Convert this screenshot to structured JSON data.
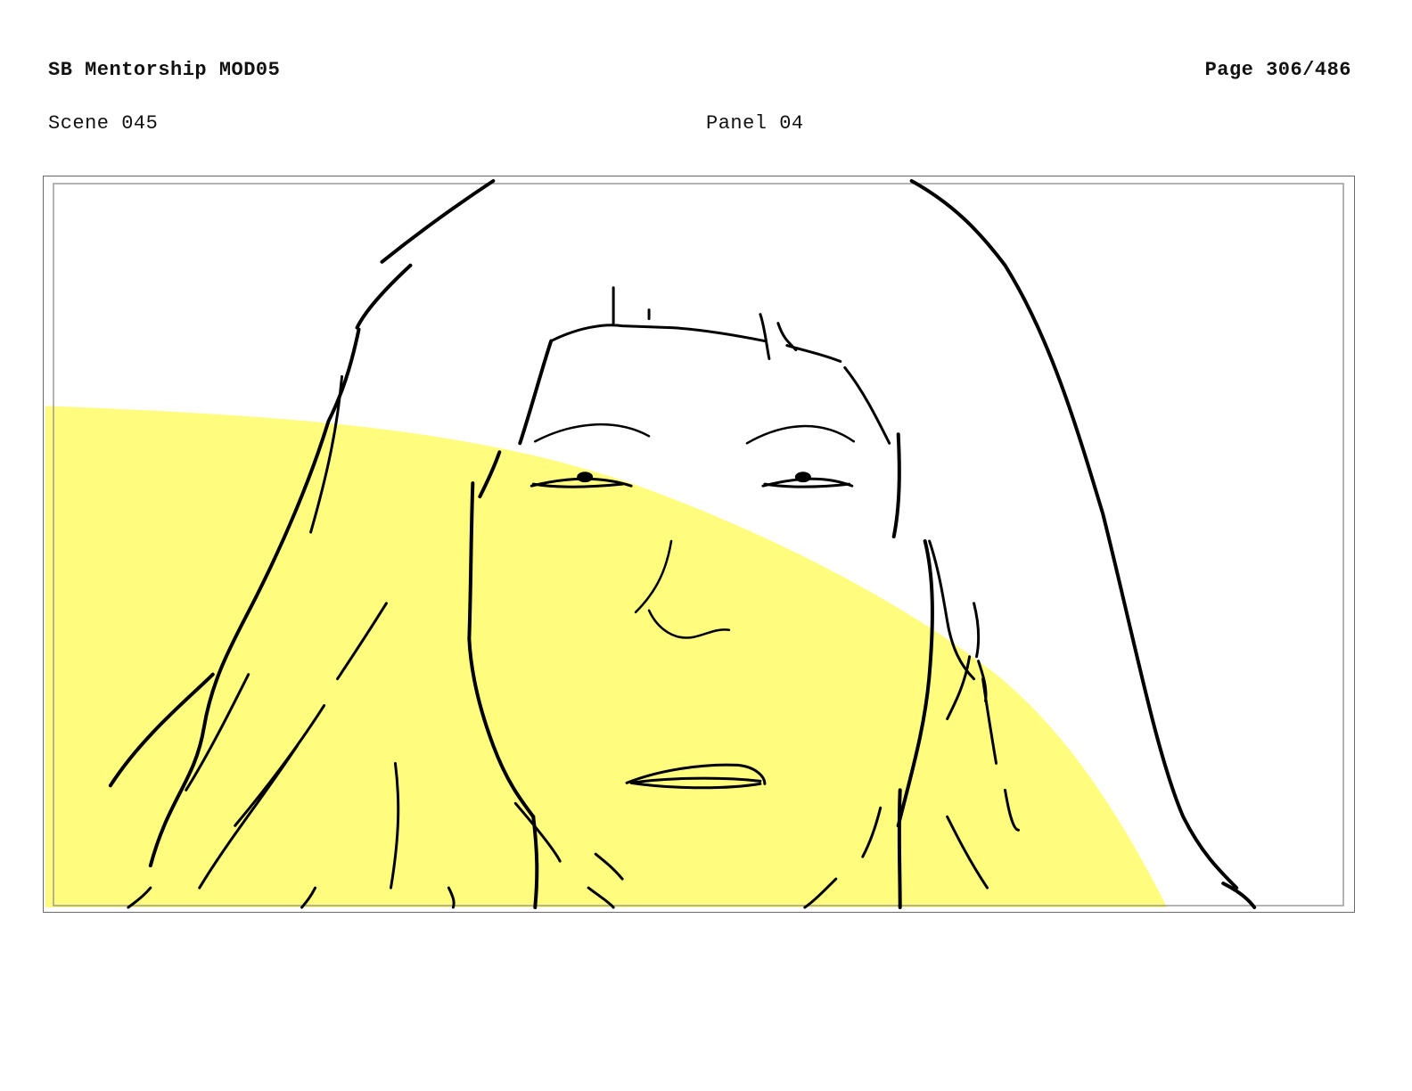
{
  "header": {
    "title": "SB Mentorship MOD05",
    "page": "Page 306/486"
  },
  "panel_info": {
    "scene": "Scene 045",
    "panel": "Panel 04"
  },
  "artwork": {
    "subject": "storyboard sketch",
    "colors": {
      "highlight": "#fffc7e",
      "line": "#000000",
      "frame": "#6a6a6a",
      "safe_area": "#9a9a9a"
    }
  }
}
